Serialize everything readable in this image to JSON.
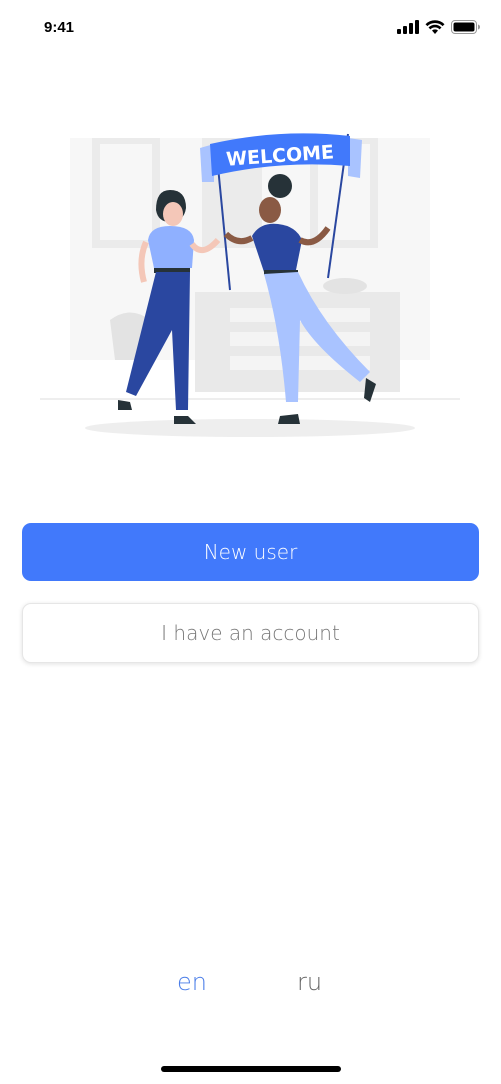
{
  "status_bar": {
    "time": "9:41",
    "icons": [
      "cellular-signal-icon",
      "wifi-icon",
      "battery-icon"
    ]
  },
  "illustration": {
    "banner_text": "WELCOME",
    "colors": {
      "dark_blue": "#2a47a0",
      "mid_blue": "#3f6ad8",
      "light_blue": "#a9c3ff",
      "banner": "#4179fb"
    }
  },
  "buttons": {
    "new_user": "New user",
    "have_account": "I have an account"
  },
  "languages": {
    "en": "en",
    "ru": "ru",
    "selected": "en"
  },
  "colors": {
    "accent": "#4179fb"
  }
}
